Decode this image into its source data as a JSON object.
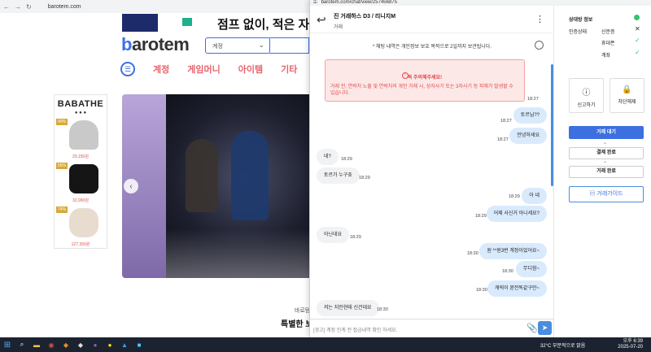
{
  "browser": {
    "url": "barotem.com"
  },
  "site": {
    "ad_banner_text": "점프 없이, 적은 자본",
    "logo_b": "b",
    "logo_rest": "arotem",
    "category_select": "계정",
    "nav": [
      "계정",
      "게임머니",
      "아이템",
      "기타"
    ],
    "side_ad": {
      "brand": "BABATHE",
      "dots": "● ● ●",
      "products": [
        {
          "tag": "40%",
          "price": "29,150원",
          "color": "#c9c9c9"
        },
        {
          "tag": "56%",
          "price": "32,990원",
          "color": "#151515"
        },
        {
          "tag": "74%",
          "price": "127,390원",
          "color": "#e8dccf"
        }
      ]
    },
    "footer_text": "바로템",
    "footer_title": "특별한 보"
  },
  "popup": {
    "url": "barotem.com/chat/view/257456875",
    "chat": {
      "title": "진 거래하스 D3 / 리니지M",
      "subtitle": "거래",
      "notice": "* 채팅 내역은 개인정보 보호 목적으로 2일까지 보관됩니다.",
      "warning_title": "꼭 주의해주세요!",
      "warning_body": "거래 전, 연락처 노출 및 연락처의 개인 거래 시, 상자사기 또는 3자사기 등 피해가 발생할 수 있습니다.",
      "warning_time": "18:27",
      "messages": [
        {
          "dir": "out",
          "text": "토르님??",
          "time": "18:27"
        },
        {
          "dir": "out",
          "text": "안녕하세요",
          "time": "18:27"
        },
        {
          "dir": "in",
          "text": "네?",
          "time": "18:29"
        },
        {
          "dir": "in",
          "text": "토르가 누구죠",
          "time": "18:29"
        },
        {
          "dir": "out",
          "text": "아 네",
          "time": "18:29"
        },
        {
          "dir": "out",
          "text": "어제 사신거 아니세요?",
          "time": "18:29"
        },
        {
          "dir": "in",
          "text": "아닌데요",
          "time": "18:29"
        },
        {
          "dir": "out",
          "text": "원 **원3번 계정이었어요~",
          "time": "18:30"
        },
        {
          "dir": "out",
          "text": "무디함~",
          "time": "18:30"
        },
        {
          "dir": "out",
          "text": "캐릭이 완전똑같구만~",
          "time": "18:30"
        },
        {
          "dir": "in",
          "text": "저는 지인현태 신건데요",
          "time": "18:30"
        }
      ],
      "input_placeholder": "[경고] 계정 인계 전 접금내역 확인 하세요."
    },
    "panel": {
      "title": "상대방 정보",
      "verify_label": "인증상태",
      "verifications": [
        {
          "label": "신분증",
          "mark": "✕",
          "color": "#333333"
        },
        {
          "label": "휴대폰",
          "mark": "✓",
          "color": "#38c172"
        },
        {
          "label": "계좌",
          "mark": "✓",
          "color": "#38c172"
        }
      ],
      "report_label": "신고하기",
      "block_label": "차단해제",
      "step_current": "거래 대기",
      "step_pay": "결제 완료",
      "step_done": "거래 완료",
      "arrow": "⌄",
      "guide_label": "거래가이드"
    }
  },
  "taskbar": {
    "weather": "32°C 부분적으로 맑음",
    "time": "오후 6:39",
    "date": "2025-07-20"
  }
}
